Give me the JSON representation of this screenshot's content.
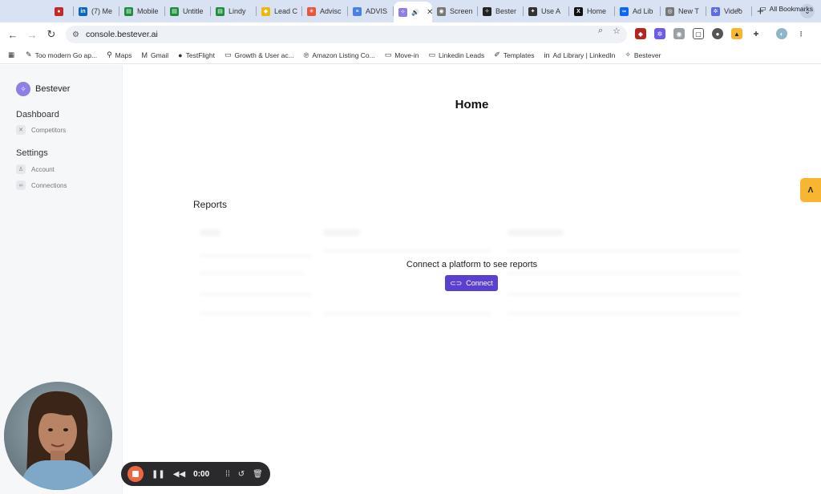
{
  "browser": {
    "tabs": [
      {
        "label": "",
        "icon": "record-icon",
        "color": "#c62828"
      },
      {
        "label": "(7) Me",
        "icon": "linkedin-icon",
        "color": "#0a66c2"
      },
      {
        "label": "Mobile",
        "icon": "sheets-icon",
        "color": "#1e8e3e"
      },
      {
        "label": "Untitle",
        "icon": "sheets-icon",
        "color": "#1e8e3e"
      },
      {
        "label": "Lindy",
        "icon": "sheets-icon",
        "color": "#1e8e3e"
      },
      {
        "label": "Lead C",
        "icon": "diamond-icon",
        "color": "#f2b705"
      },
      {
        "label": "Advisc",
        "icon": "asterisk-icon",
        "color": "#e8563a"
      },
      {
        "label": "ADVIS",
        "icon": "docs-icon",
        "color": "#4a7fe6"
      },
      {
        "label": "",
        "icon": "bestever-icon",
        "color": "#8f7ee6",
        "active": true
      },
      {
        "label": "Screen",
        "icon": "camera-icon",
        "color": "#777777"
      },
      {
        "label": "Bester",
        "icon": "bestever-icon",
        "color": "#222222"
      },
      {
        "label": "Use A",
        "icon": "sparkle-icon",
        "color": "#333333"
      },
      {
        "label": "Home",
        "icon": "x-icon",
        "color": "#111111"
      },
      {
        "label": "Ad Lib",
        "icon": "meta-icon",
        "color": "#0866ff"
      },
      {
        "label": "New T",
        "icon": "chrome-icon",
        "color": "#777777"
      },
      {
        "label": "Video",
        "icon": "gear-icon",
        "color": "#5b6de6"
      }
    ],
    "url": "console.bestever.ai",
    "bookmarks": [
      {
        "label": "Too modern Go ap...",
        "icon": "pen-icon"
      },
      {
        "label": "Maps",
        "icon": "maps-icon"
      },
      {
        "label": "Gmail",
        "icon": "gmail-icon"
      },
      {
        "label": "TestFlight",
        "icon": "apple-icon"
      },
      {
        "label": "Growth & User ac...",
        "icon": "folder-icon"
      },
      {
        "label": "Amazon Listing Co...",
        "icon": "pinterest-icon"
      },
      {
        "label": "Move-in",
        "icon": "folder-icon"
      },
      {
        "label": "Linkedin Leads",
        "icon": "folder-icon"
      },
      {
        "label": "Templates",
        "icon": "notion-icon"
      },
      {
        "label": "Ad Library | LinkedIn",
        "icon": "linkedin-icon"
      },
      {
        "label": "Bestever",
        "icon": "bestever-icon"
      }
    ],
    "all_bookmarks": "All Bookmarks",
    "overflow": "»"
  },
  "sidebar": {
    "brand": "Bestever",
    "sections": [
      {
        "heading": "Dashboard",
        "items": [
          {
            "label": "Competitors",
            "icon": "competitors-icon"
          }
        ]
      },
      {
        "heading": "Settings",
        "items": [
          {
            "label": "Account",
            "icon": "user-icon"
          },
          {
            "label": "Connections",
            "icon": "link-icon"
          }
        ]
      }
    ]
  },
  "main": {
    "title": "Home",
    "reports_title": "Reports",
    "empty_message": "Connect a platform to see reports",
    "connect_label": "Connect"
  },
  "recorder": {
    "time": "0:00"
  },
  "colors": {
    "accent": "#5b3fd1",
    "brand": "#8f7ee6",
    "side_tab": "#f7b531",
    "record": "#f2643d"
  }
}
